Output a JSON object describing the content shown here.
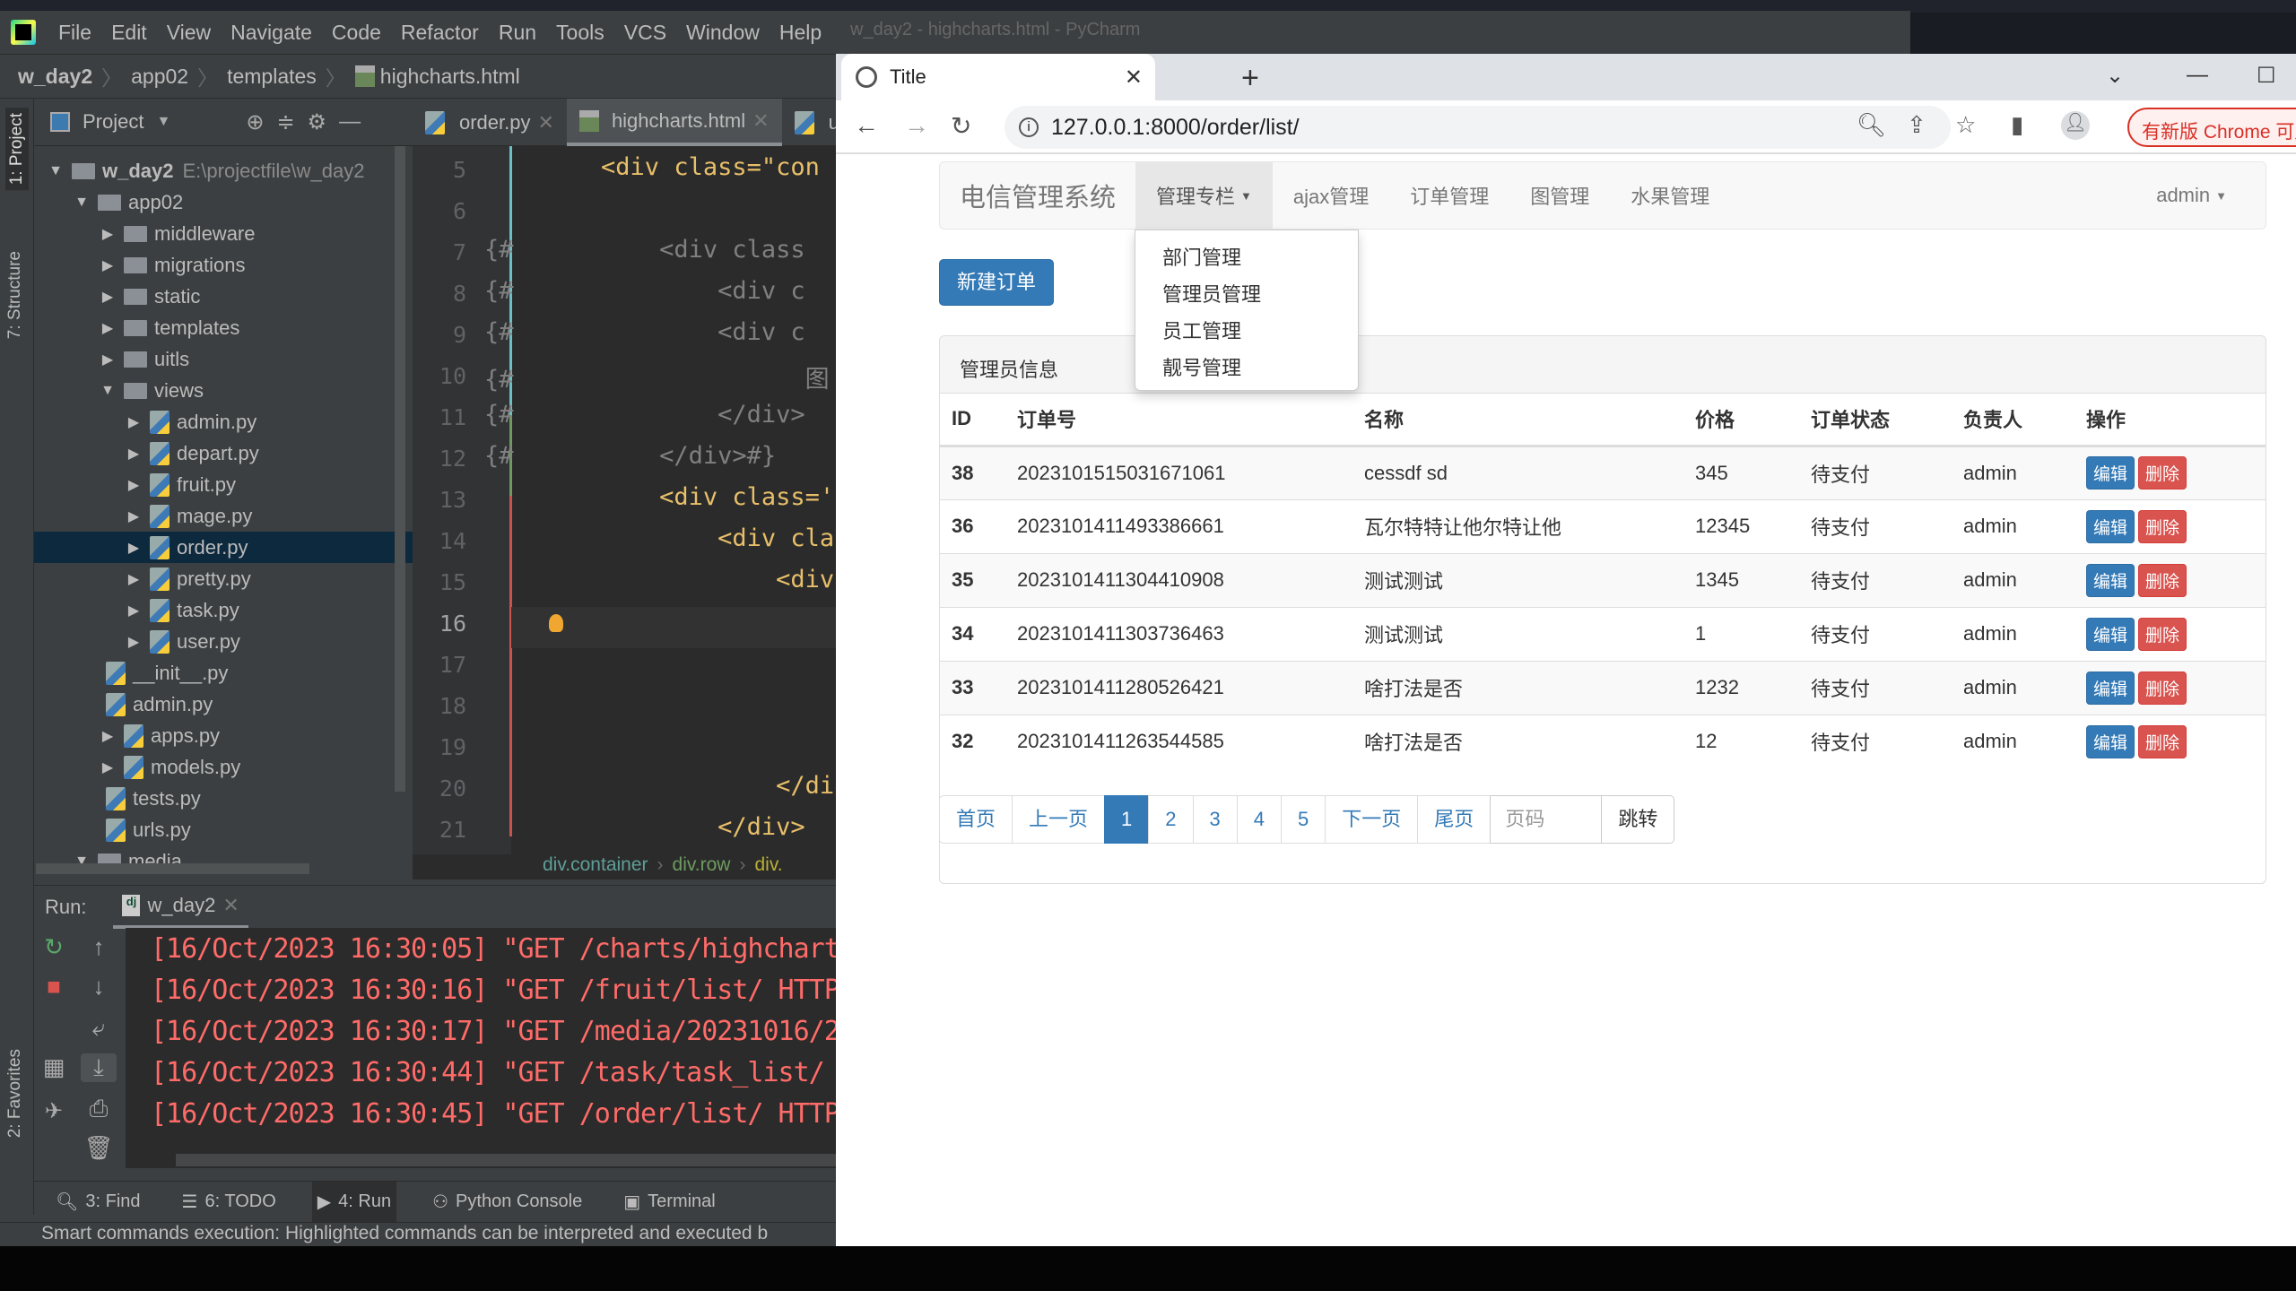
{
  "ide": {
    "window_title": "w_day2 - highcharts.html - PyCharm",
    "menu": [
      "File",
      "Edit",
      "View",
      "Navigate",
      "Code",
      "Refactor",
      "Run",
      "Tools",
      "VCS",
      "Window",
      "Help"
    ],
    "breadcrumb": [
      "w_day2",
      "app02",
      "templates",
      "highcharts.html"
    ],
    "side_tabs": {
      "project": "1: Project",
      "structure": "7: Structure",
      "favorites": "2: Favorites"
    },
    "project_header": "Project",
    "tree": [
      {
        "label": "w_day2",
        "path": "E:\\projectfile\\w_day2",
        "level": 0,
        "type": "folder",
        "expanded": true
      },
      {
        "label": "app02",
        "level": 1,
        "type": "folder",
        "expanded": true
      },
      {
        "label": "middleware",
        "level": 2,
        "type": "folder",
        "expanded": false
      },
      {
        "label": "migrations",
        "level": 2,
        "type": "folder",
        "expanded": false
      },
      {
        "label": "static",
        "level": 2,
        "type": "folder",
        "expanded": false
      },
      {
        "label": "templates",
        "level": 2,
        "type": "folder",
        "expanded": false
      },
      {
        "label": "uitls",
        "level": 2,
        "type": "folder",
        "expanded": false
      },
      {
        "label": "views",
        "level": 2,
        "type": "folder",
        "expanded": true
      },
      {
        "label": "admin.py",
        "level": 3,
        "type": "py",
        "expandable": true
      },
      {
        "label": "depart.py",
        "level": 3,
        "type": "py",
        "expandable": true
      },
      {
        "label": "fruit.py",
        "level": 3,
        "type": "py",
        "expandable": true
      },
      {
        "label": "mage.py",
        "level": 3,
        "type": "py",
        "expandable": true
      },
      {
        "label": "order.py",
        "level": 3,
        "type": "py",
        "expandable": true,
        "selected": true
      },
      {
        "label": "pretty.py",
        "level": 3,
        "type": "py",
        "expandable": true
      },
      {
        "label": "task.py",
        "level": 3,
        "type": "py",
        "expandable": true
      },
      {
        "label": "user.py",
        "level": 3,
        "type": "py",
        "expandable": true
      },
      {
        "label": "__init__.py",
        "level": 2,
        "type": "py"
      },
      {
        "label": "admin.py",
        "level": 2,
        "type": "py"
      },
      {
        "label": "apps.py",
        "level": 2,
        "type": "py",
        "expandable": true
      },
      {
        "label": "models.py",
        "level": 2,
        "type": "py",
        "expandable": true
      },
      {
        "label": "tests.py",
        "level": 2,
        "type": "py"
      },
      {
        "label": "urls.py",
        "level": 2,
        "type": "py"
      },
      {
        "label": "media",
        "level": 1,
        "type": "folder",
        "expanded": true
      }
    ],
    "editor_tabs": [
      {
        "label": "order.py",
        "active": false
      },
      {
        "label": "highcharts.html",
        "active": true
      },
      {
        "label": "u",
        "active": false
      }
    ],
    "code_lines": [
      {
        "n": "5",
        "text": "        <div class=\"con",
        "kind": "tag"
      },
      {
        "n": "6",
        "text": "",
        "kind": "plain"
      },
      {
        "n": "7",
        "text": "{#          <div class",
        "kind": "cm"
      },
      {
        "n": "8",
        "text": "{#              <div c",
        "kind": "cm"
      },
      {
        "n": "9",
        "text": "{#              <div c",
        "kind": "cm"
      },
      {
        "n": "10",
        "text": "{#                    图",
        "kind": "cm"
      },
      {
        "n": "11",
        "text": "{#              </div>",
        "kind": "cm"
      },
      {
        "n": "12",
        "text": "{#          </div>#}",
        "kind": "cm"
      },
      {
        "n": "13",
        "text": "            <div class='",
        "kind": "tag"
      },
      {
        "n": "14",
        "text": "                <div cla",
        "kind": "tag"
      },
      {
        "n": "15",
        "text": "                    <div",
        "kind": "tag"
      },
      {
        "n": "16",
        "text": "",
        "kind": "plain",
        "current": true
      },
      {
        "n": "17",
        "text": "",
        "kind": "plain"
      },
      {
        "n": "18",
        "text": "",
        "kind": "plain"
      },
      {
        "n": "19",
        "text": "",
        "kind": "plain"
      },
      {
        "n": "20",
        "text": "                    </di",
        "kind": "tag"
      },
      {
        "n": "21",
        "text": "                </div>",
        "kind": "tag"
      }
    ],
    "editor_breadcrumb": [
      "div.container",
      "div.row",
      "div."
    ],
    "run": {
      "label": "Run:",
      "config": "w_day2",
      "logs": [
        "[16/Oct/2023 16:30:05] \"GET /charts/highchart",
        "[16/Oct/2023 16:30:16] \"GET /fruit/list/ HTTP",
        "[16/Oct/2023 16:30:17] \"GET /media/20231016/2",
        "[16/Oct/2023 16:30:44] \"GET /task/task_list/ ",
        "[16/Oct/2023 16:30:45] \"GET /order/list/ HTTP"
      ]
    },
    "bottom_tabs": [
      {
        "label": "3: Find",
        "icon": "search-icon"
      },
      {
        "label": "6: TODO",
        "icon": "list-icon"
      },
      {
        "label": "4: Run",
        "icon": "run-icon",
        "active": true
      },
      {
        "label": "Python Console",
        "icon": "python-icon"
      },
      {
        "label": "Terminal",
        "icon": "terminal-icon"
      }
    ],
    "status": "Smart commands execution: Highlighted commands can be interpreted and executed b"
  },
  "browser": {
    "tab_title": "Title",
    "url": "127.0.0.1:8000/order/list/",
    "update_label": "有新版 Chrome 可用",
    "navbar": {
      "brand": "电信管理系统",
      "items": [
        "管理专栏",
        "ajax管理",
        "订单管理",
        "图管理",
        "水果管理"
      ],
      "user": "admin"
    },
    "dropdown": [
      "部门管理",
      "管理员管理",
      "员工管理",
      "靓号管理"
    ],
    "new_button": "新建订单",
    "panel_title": "管理员信息",
    "columns": [
      "ID",
      "订单号",
      "名称",
      "价格",
      "订单状态",
      "负责人",
      "操作"
    ],
    "rows": [
      {
        "id": "38",
        "oid": "2023101515031671061",
        "title": "cessdf sd",
        "price": "345",
        "status": "待支付",
        "admin": "admin"
      },
      {
        "id": "36",
        "oid": "2023101411493386661",
        "title": "瓦尔特特让他尔特让他",
        "price": "12345",
        "status": "待支付",
        "admin": "admin"
      },
      {
        "id": "35",
        "oid": "2023101411304410908",
        "title": "测试测试",
        "price": "1345",
        "status": "待支付",
        "admin": "admin"
      },
      {
        "id": "34",
        "oid": "2023101411303736463",
        "title": "测试测试",
        "price": "1",
        "status": "待支付",
        "admin": "admin"
      },
      {
        "id": "33",
        "oid": "2023101411280526421",
        "title": "啥打法是否",
        "price": "1232",
        "status": "待支付",
        "admin": "admin"
      },
      {
        "id": "32",
        "oid": "2023101411263544585",
        "title": "啥打法是否",
        "price": "12",
        "status": "待支付",
        "admin": "admin"
      }
    ],
    "edit_label": "编辑",
    "delete_label": "删除",
    "pager": {
      "first": "首页",
      "prev": "上一页",
      "pages": [
        "1",
        "2",
        "3",
        "4",
        "5"
      ],
      "current": "1",
      "next": "下一页",
      "last": "尾页",
      "placeholder": "页码",
      "jump": "跳转"
    },
    "colors": {
      "primary": "#337ab7",
      "danger": "#d9534f"
    }
  }
}
